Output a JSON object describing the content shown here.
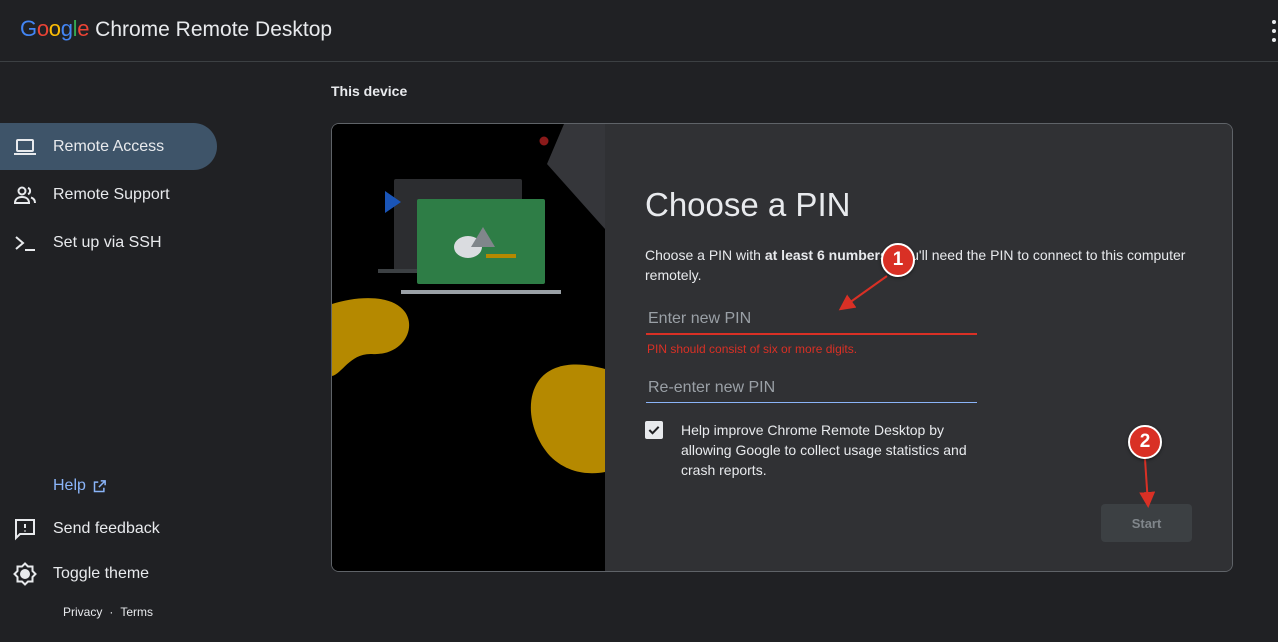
{
  "header": {
    "logo_letters": [
      "G",
      "o",
      "o",
      "g",
      "l",
      "e"
    ],
    "logo_colors": [
      "#4285f4",
      "#ea4335",
      "#fbbc05",
      "#4285f4",
      "#34a853",
      "#ea4335"
    ],
    "product_name": "Chrome Remote Desktop",
    "menu_icon": "more-vert-icon"
  },
  "sidebar": {
    "items": [
      {
        "label": "Remote Access",
        "icon": "laptop-icon",
        "active": true
      },
      {
        "label": "Remote Support",
        "icon": "people-icon",
        "active": false
      },
      {
        "label": "Set up via SSH",
        "icon": "terminal-icon",
        "active": false
      }
    ],
    "help_label": "Help",
    "feedback_label": "Send feedback",
    "theme_label": "Toggle theme",
    "privacy_label": "Privacy",
    "separator": "·",
    "terms_label": "Terms"
  },
  "main": {
    "section_title": "This device",
    "pin": {
      "title": "Choose a PIN",
      "desc_pre": "Choose a PIN with ",
      "desc_bold": "at least 6 numbers.",
      "desc_post": " You'll need the PIN to connect to this computer remotely.",
      "pin_placeholder": "Enter new PIN",
      "pin_value": "",
      "pin_error": "PIN should consist of six or more digits.",
      "reenter_placeholder": "Re-enter new PIN",
      "reenter_value": "",
      "consent_checked": true,
      "consent_label": "Help improve Chrome Remote Desktop by allowing Google to collect usage statistics and crash reports.",
      "start_label": "Start"
    }
  },
  "annotations": [
    {
      "number": "1"
    },
    {
      "number": "2"
    }
  ],
  "colors": {
    "background": "#202124",
    "accent": "#8ab4f8",
    "active_nav": "#3e5469",
    "error": "#d93025",
    "illustration_green": "#2e7d46",
    "illustration_gold": "#b58900",
    "illustration_blue": "#1a55b8"
  }
}
